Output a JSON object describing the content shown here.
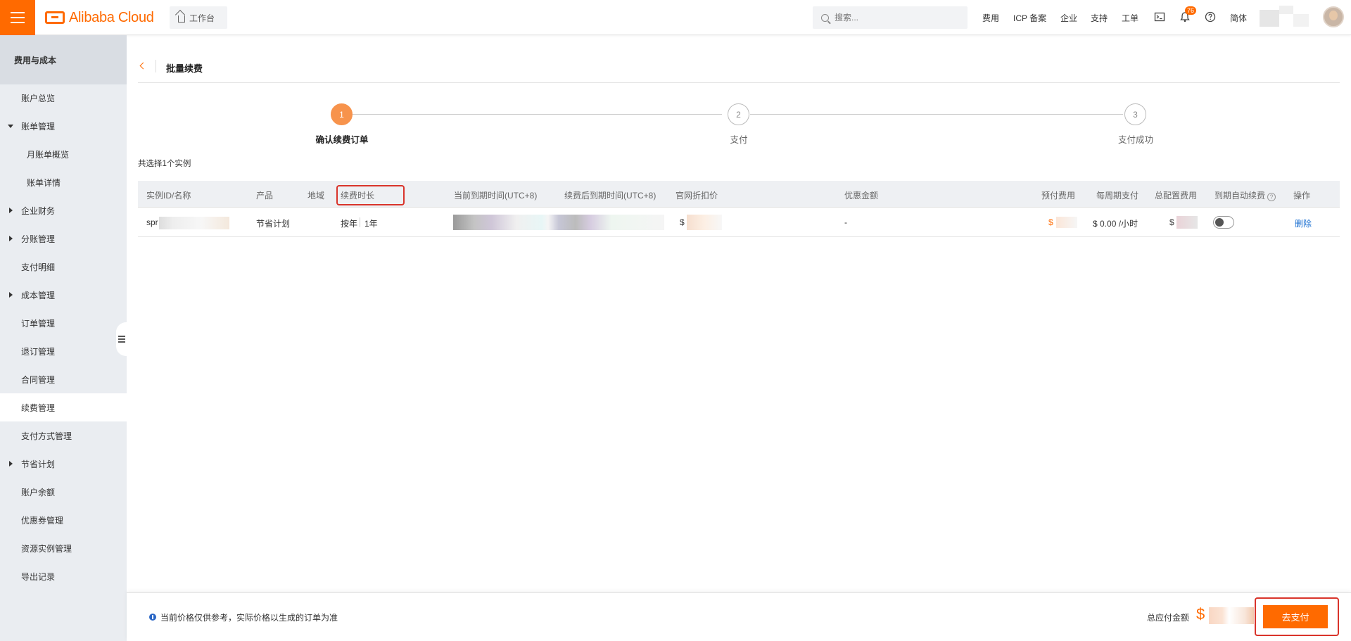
{
  "header": {
    "brand": "Alibaba Cloud",
    "workbench_label": "工作台",
    "search_placeholder": "搜索...",
    "nav_links": [
      "费用",
      "ICP 备案",
      "企业",
      "支持",
      "工单"
    ],
    "notification_count": "76",
    "language_label": "简体",
    "accent_color": "#ff6a00"
  },
  "sidebar": {
    "title": "费用与成本",
    "items": [
      {
        "label": "账户总览"
      },
      {
        "label": "账单管理"
      },
      {
        "label": "月账单概览"
      },
      {
        "label": "账单详情"
      },
      {
        "label": "企业财务"
      },
      {
        "label": "分账管理"
      },
      {
        "label": "支付明细"
      },
      {
        "label": "成本管理"
      },
      {
        "label": "订单管理"
      },
      {
        "label": "退订管理"
      },
      {
        "label": "合同管理"
      },
      {
        "label": "续费管理"
      },
      {
        "label": "支付方式管理"
      },
      {
        "label": "节省计划"
      },
      {
        "label": "账户余额"
      },
      {
        "label": "优惠券管理"
      },
      {
        "label": "资源实例管理"
      },
      {
        "label": "导出记录"
      }
    ],
    "active_item": "续费管理"
  },
  "page": {
    "title": "批量续费",
    "steps": [
      {
        "number": "1",
        "label": "确认续费订单"
      },
      {
        "number": "2",
        "label": "支付"
      },
      {
        "number": "3",
        "label": "支付成功"
      }
    ],
    "selected_text": "共选择1个实例"
  },
  "table": {
    "headers": {
      "instance": "实例ID/名称",
      "product": "产品",
      "region": "地域",
      "duration": "续费时长",
      "current_expiry": "当前到期时间(UTC+8)",
      "new_expiry": "续费后到期时间(UTC+8)",
      "list_price": "官网折扣价",
      "discount": "优惠金额",
      "prepaid": "预付费用",
      "per_period": "每周期支付",
      "total_config": "总配置费用",
      "auto_renew": "到期自动续费",
      "actions": "操作"
    },
    "row": {
      "instance_prefix": "spr",
      "product": "节省计划",
      "duration_unit": "按年",
      "duration_value": "1年",
      "list_price_prefix": "$",
      "discount": "-",
      "prepaid_prefix": "$",
      "per_period": "$ 0.00 /小时",
      "total_prefix": "$",
      "delete_label": "删除"
    }
  },
  "footer": {
    "note": "当前价格仅供参考，实际价格以生成的订单为准",
    "total_label": "总应付金额",
    "total_currency": "$",
    "pay_button": "去支付"
  }
}
